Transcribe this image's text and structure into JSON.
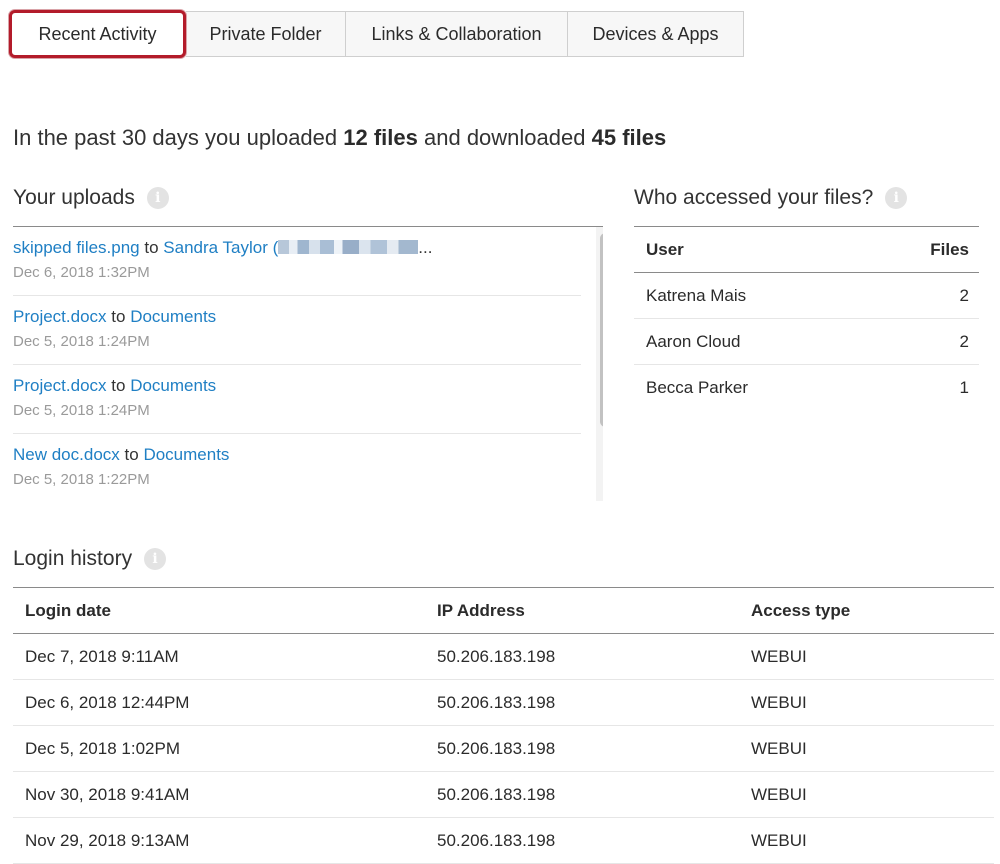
{
  "tabs": [
    {
      "label": "Recent Activity",
      "active": true
    },
    {
      "label": "Private Folder",
      "active": false
    },
    {
      "label": "Links & Collaboration",
      "active": false
    },
    {
      "label": "Devices & Apps",
      "active": false
    }
  ],
  "summary": {
    "prefix": "In the past 30 days you uploaded",
    "uploaded": "12 files",
    "middle": "and downloaded",
    "downloaded": "45 files"
  },
  "uploads": {
    "title": "Your uploads",
    "info_icon": "info-icon",
    "items": [
      {
        "file": "skipped files.png",
        "to": "to",
        "dest": "Sandra Taylor (",
        "dest_suffix": "...",
        "redacted": true,
        "date": "Dec 6, 2018 1:32PM"
      },
      {
        "file": "Project.docx",
        "to": "to",
        "dest": "Documents",
        "date": "Dec 5, 2018 1:24PM"
      },
      {
        "file": "Project.docx",
        "to": "to",
        "dest": "Documents",
        "date": "Dec 5, 2018 1:24PM"
      },
      {
        "file": "New doc.docx",
        "to": "to",
        "dest": "Documents",
        "date": "Dec 5, 2018 1:22PM"
      }
    ]
  },
  "access": {
    "title": "Who accessed your files?",
    "info_icon": "info-icon",
    "headers": {
      "user": "User",
      "files": "Files"
    },
    "rows": [
      {
        "user": "Katrena Mais",
        "files": "2"
      },
      {
        "user": "Aaron Cloud",
        "files": "2"
      },
      {
        "user": "Becca Parker",
        "files": "1"
      }
    ]
  },
  "login": {
    "title": "Login history",
    "info_icon": "info-icon",
    "headers": {
      "date": "Login date",
      "ip": "IP Address",
      "type": "Access type"
    },
    "rows": [
      {
        "date": "Dec 7, 2018 9:11AM",
        "ip": "50.206.183.198",
        "type": "WEBUI"
      },
      {
        "date": "Dec 6, 2018 12:44PM",
        "ip": "50.206.183.198",
        "type": "WEBUI"
      },
      {
        "date": "Dec 5, 2018 1:02PM",
        "ip": "50.206.183.198",
        "type": "WEBUI"
      },
      {
        "date": "Nov 30, 2018 9:41AM",
        "ip": "50.206.183.198",
        "type": "WEBUI"
      },
      {
        "date": "Nov 29, 2018 9:13AM",
        "ip": "50.206.183.198",
        "type": "WEBUI"
      }
    ]
  },
  "colors": {
    "accent_link": "#1f7fc4",
    "active_tab_border": "#b31b2a"
  }
}
